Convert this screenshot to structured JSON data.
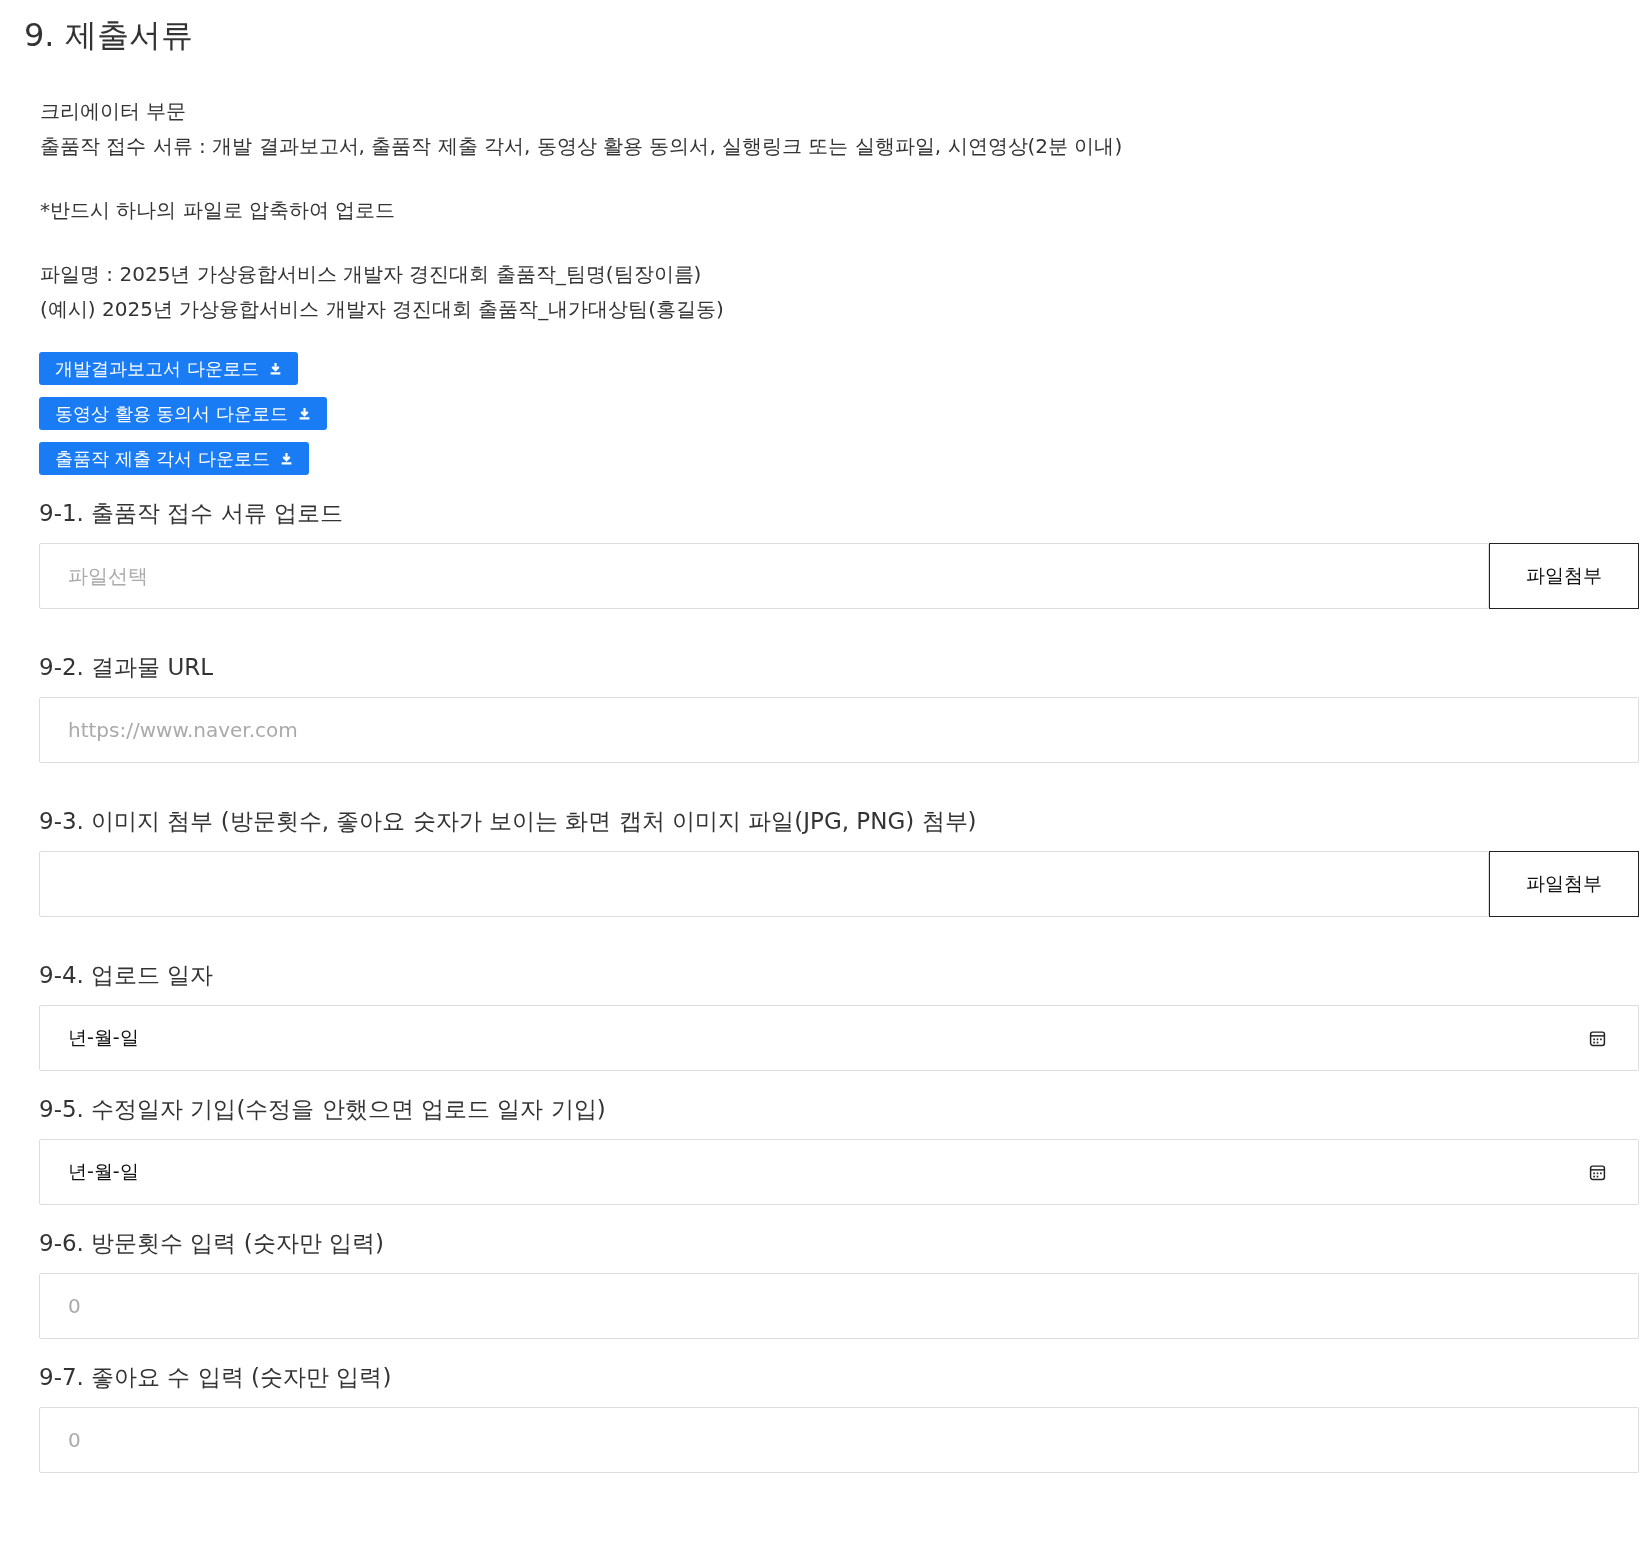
{
  "title": "9. 제출서류",
  "intro": [
    [
      "크리에이터 부문",
      "출품작 접수 서류 : 개발 결과보고서, 출품작 제출 각서, 동영상 활용 동의서, 실행링크 또는 실행파일, 시연영상(2분 이내)"
    ],
    [
      "*반드시 하나의 파일로 압축하여 업로드"
    ],
    [
      "파일명 : 2025년 가상융합서비스 개발자 경진대회 출품작_팀명(팀장이름)",
      "(예시) 2025년 가상융합서비스 개발자 경진대회 출품작_내가대상팀(홍길동)"
    ]
  ],
  "downloads": [
    "개발결과보고서 다운로드",
    "동영상 활용 동의서 다운로드",
    "출품작 제출 각서 다운로드"
  ],
  "fields": [
    {
      "label": "9-1. 출품작 접수 서류 업로드",
      "kind": "file",
      "placeholder": "파일선택",
      "button": "파일첨부"
    },
    {
      "label": "9-2. 결과물 URL",
      "kind": "url",
      "placeholder": "https://www.naver.com"
    },
    {
      "label": "9-3. 이미지 첨부 (방문횟수, 좋아요 숫자가 보이는 화면 캡처 이미지 파일(JPG, PNG) 첨부)",
      "kind": "file",
      "button": "파일첨부"
    },
    {
      "label": "9-4. 업로드 일자",
      "kind": "date",
      "value": "년-월-일"
    },
    {
      "label": "9-5. 수정일자 기입(수정을 안했으면 업로드 일자 기입)",
      "kind": "date",
      "value": "년-월-일"
    },
    {
      "label": "9-6. 방문횟수 입력 (숫자만 입력)",
      "kind": "number",
      "placeholder": "0"
    },
    {
      "label": "9-7. 좋아요 수 입력 (숫자만 입력)",
      "kind": "number",
      "placeholder": "0"
    }
  ]
}
